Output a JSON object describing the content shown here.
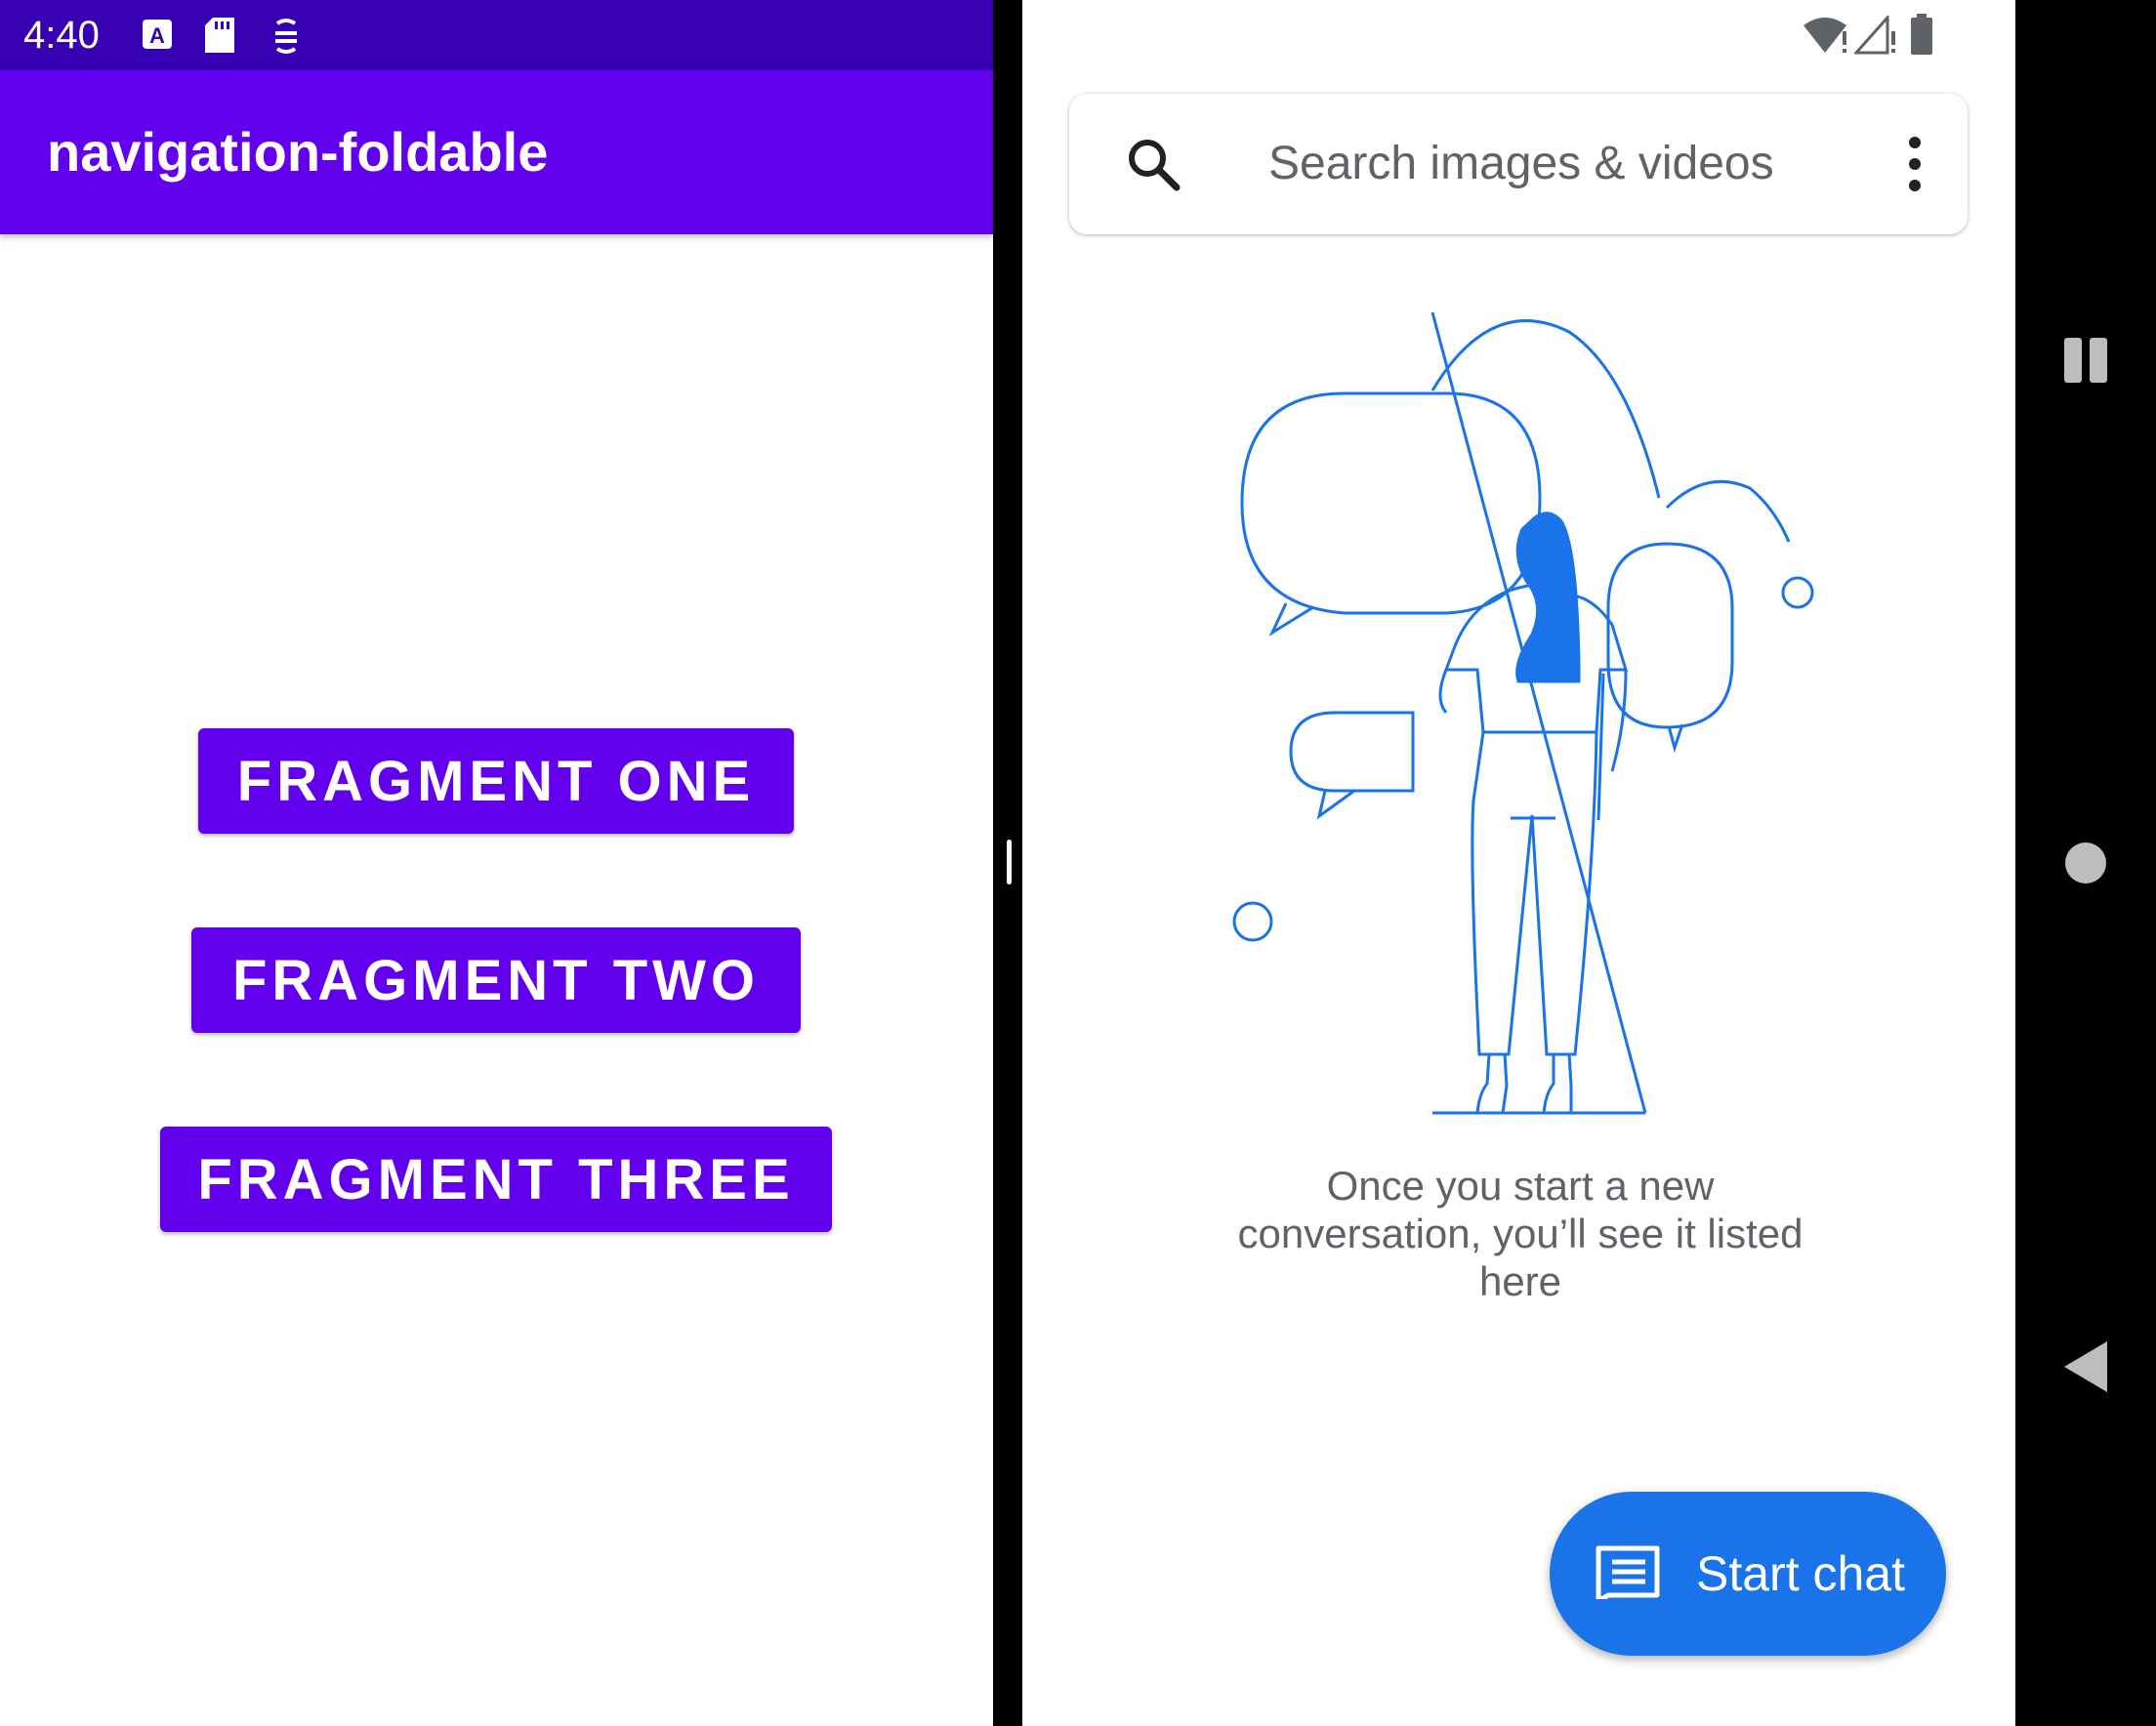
{
  "status_bar": {
    "time": "4:40",
    "left_icons": [
      "accessibility-a-icon",
      "sd-card-icon",
      "tracker-icon"
    ],
    "right_icons": [
      "wifi-alert-icon",
      "signal-alert-icon",
      "battery-icon"
    ]
  },
  "left_app": {
    "title": "navigation-foldable",
    "buttons": [
      {
        "label": "FRAGMENT ONE"
      },
      {
        "label": "FRAGMENT TWO"
      },
      {
        "label": "FRAGMENT THREE"
      }
    ],
    "colors": {
      "primary": "#6200ee",
      "primary_dark": "#3700b3"
    }
  },
  "right_app": {
    "search": {
      "placeholder": "Search images & videos"
    },
    "empty_state": {
      "line1": "Once you start a new",
      "line2": "conversation, you’ll see it listed",
      "line3": "here"
    },
    "fab": {
      "label": "Start chat"
    },
    "colors": {
      "accent": "#1a73e8",
      "text_secondary": "#5f6368"
    }
  },
  "nav_bar": {
    "buttons": [
      "recents-icon",
      "home-icon",
      "back-icon"
    ]
  }
}
